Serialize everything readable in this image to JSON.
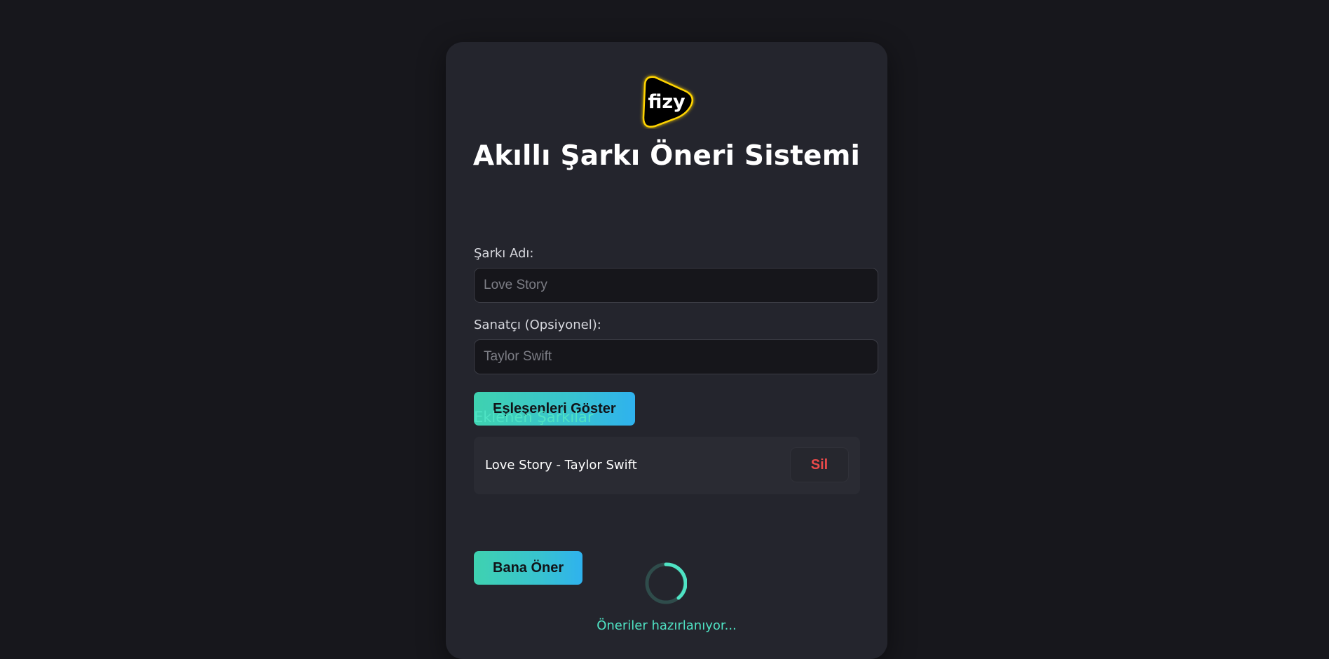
{
  "app": {
    "logo_text": "fizy",
    "title": "Akıllı Şarkı Öneri Sistemi"
  },
  "form": {
    "song": {
      "label": "Şarkı Adı:",
      "placeholder": "Love Story",
      "value": ""
    },
    "artist": {
      "label": "Sanatçı (Opsiyonel):",
      "placeholder": "Taylor Swift",
      "value": ""
    },
    "show_matches_label": "Eşleşenleri Göster"
  },
  "added_songs": {
    "title": "Eklenen Şarkılar",
    "items": [
      {
        "text": "Love Story - Taylor Swift",
        "delete_label": "Sil"
      }
    ]
  },
  "recommend_label": "Bana Öner",
  "loading": {
    "text": "Öneriler hazırlanıyor..."
  },
  "colors": {
    "background": "#17171c",
    "card": "#24252d",
    "accent_start": "#3fd2b0",
    "accent_end": "#2fb2ee",
    "accent_text": "#4fe3c4",
    "danger": "#ea4a4a",
    "logo_glow": "#ffd400"
  },
  "icons": {
    "logo": "fizy-logo-icon",
    "spinner": "loading-spinner-icon"
  }
}
